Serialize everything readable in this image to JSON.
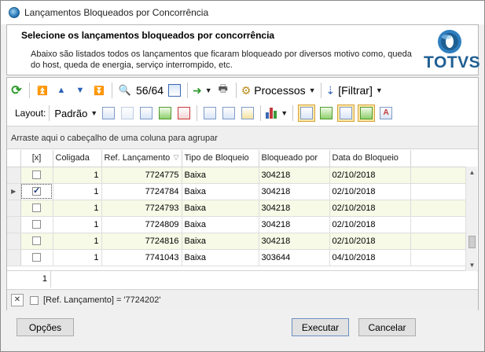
{
  "window": {
    "title": "Lançamentos Bloqueados por Concorrência"
  },
  "header": {
    "title": "Selecione os lançamentos bloqueados por concorrência",
    "description": "Abaixo são listados todos os lançamentos que ficaram bloqueado por diversos motivo como, queda do host, queda de energia, serviço interrompido, etc.",
    "logo_text": "TOTVS"
  },
  "toolbar": {
    "page_counter": "56/64",
    "processos_label": "Processos",
    "filtrar_label": "[Filtrar]"
  },
  "toolbar2": {
    "layout_label": "Layout:",
    "padrao_label": "Padrão"
  },
  "grid": {
    "group_hint": "Arraste aqui o cabeçalho de uma coluna para agrupar",
    "columns": [
      "[x]",
      "Coligada",
      "Ref. Lançamento",
      "Tipo de Bloqueio",
      "Bloqueado por",
      "Data do Bloqueio"
    ],
    "rows": [
      {
        "checked": false,
        "coligada": "1",
        "ref": "7724775",
        "tipo": "Baixa",
        "bloqueado_por": "304218",
        "data": "02/10/2018"
      },
      {
        "checked": true,
        "coligada": "1",
        "ref": "7724784",
        "tipo": "Baixa",
        "bloqueado_por": "304218",
        "data": "02/10/2018"
      },
      {
        "checked": false,
        "coligada": "1",
        "ref": "7724793",
        "tipo": "Baixa",
        "bloqueado_por": "304218",
        "data": "02/10/2018"
      },
      {
        "checked": false,
        "coligada": "1",
        "ref": "7724809",
        "tipo": "Baixa",
        "bloqueado_por": "304218",
        "data": "02/10/2018"
      },
      {
        "checked": false,
        "coligada": "1",
        "ref": "7724816",
        "tipo": "Baixa",
        "bloqueado_por": "304218",
        "data": "02/10/2018"
      },
      {
        "checked": false,
        "coligada": "1",
        "ref": "7741043",
        "tipo": "Baixa",
        "bloqueado_por": "303644",
        "data": "04/10/2018"
      }
    ],
    "footer_count": "1",
    "filter_text": "[Ref. Lançamento] = '7724202'"
  },
  "buttons": {
    "opcoes": "Opções",
    "executar": "Executar",
    "cancelar": "Cancelar"
  },
  "colors": {
    "accent_blue": "#1f5f93",
    "row_alt": "#f6fae6"
  }
}
